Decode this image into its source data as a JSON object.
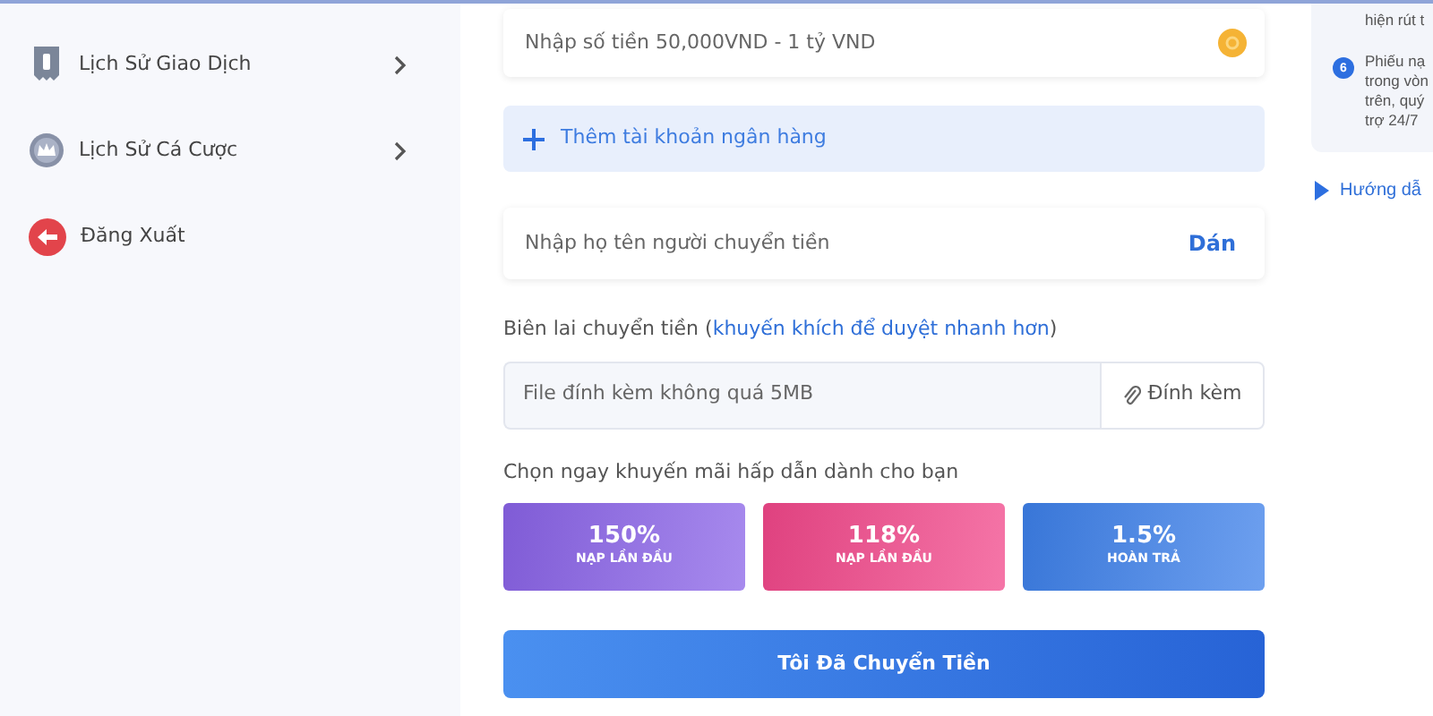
{
  "sidebar": {
    "items": [
      {
        "label": "Lịch Sử Giao Dịch",
        "chevron": true
      },
      {
        "label": "Lịch Sử Cá Cược",
        "chevron": true
      },
      {
        "label": "Đăng Xuất",
        "chevron": false
      }
    ]
  },
  "form": {
    "amount": {
      "placeholder": "Nhập số tiền 50,000VND - 1 tỷ VND"
    },
    "add_bank": {
      "label": "Thêm tài khoản ngân hàng"
    },
    "sender": {
      "placeholder": "Nhập họ tên người chuyển tiền",
      "action": "Dán"
    },
    "receipt_label": {
      "text": "Biên lai chuyển tiền (",
      "link": "khuyến khích để duyệt nhanh hơn",
      "suffix": ")"
    },
    "file": {
      "placeholder": "File đính kèm không quá 5MB",
      "action": "Đính kèm"
    },
    "promo_label": "Chọn ngay khuyến mãi hấp dẫn dành cho bạn",
    "promos": [
      {
        "value": "150%",
        "caption": "NẠP LẦN ĐẦU",
        "color": "#8a63e8"
      },
      {
        "value": "118%",
        "caption": "NẠP LẦN ĐẦU",
        "color": "#f2478a"
      },
      {
        "value": "1.5%",
        "caption": "HOÀN TRẢ",
        "color": "#3d80ea"
      }
    ],
    "submit": "Tôi Đã Chuyển Tiền"
  },
  "notes": {
    "items": [
      {
        "lines": [
          "hiện rút t"
        ]
      },
      {
        "number": "6",
        "lines": [
          "Phiếu nạ",
          "trong vòn",
          "trên, quý",
          "trợ 24/7"
        ]
      }
    ],
    "guide": "Hướng dẫ"
  }
}
